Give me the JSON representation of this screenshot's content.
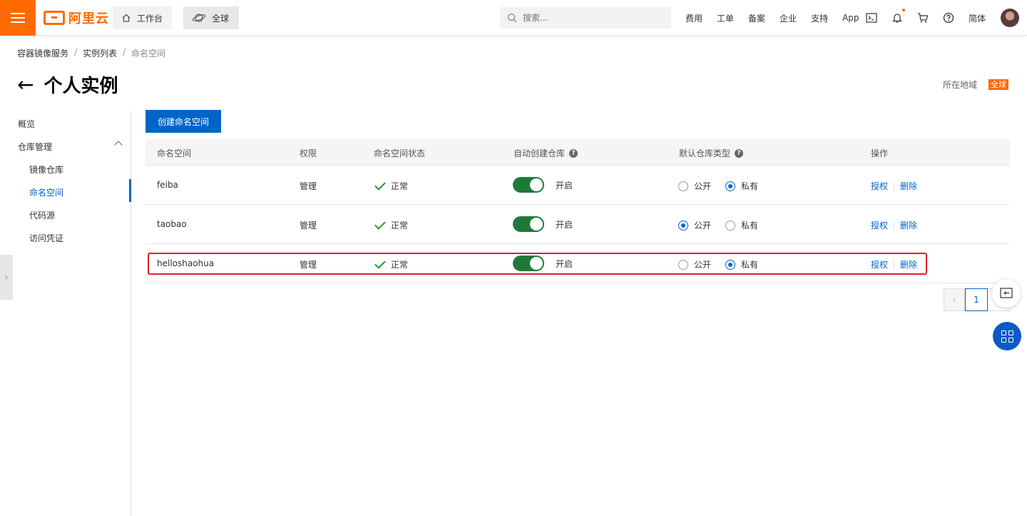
{
  "topbar": {
    "logo_text": "阿里云",
    "workbench_label": "工作台",
    "global_label": "全球",
    "search_placeholder": "搜索...",
    "nav": [
      "费用",
      "工单",
      "备案",
      "企业",
      "支持",
      "App"
    ],
    "lang_label": "简体",
    "accent_color": "#ff6a00"
  },
  "breadcrumb": {
    "items": [
      "容器镜像服务",
      "实例列表",
      "命名空间"
    ],
    "separator": "/"
  },
  "page": {
    "back_arrow": "←",
    "title": "个人实例",
    "region_label": "所在地域",
    "region_value": "全球"
  },
  "sidebar": {
    "overview": "概览",
    "repo_mgmt": "仓库管理",
    "items": [
      "镜像仓库",
      "命名空间",
      "代码源",
      "访问凭证"
    ],
    "active_item": "命名空间"
  },
  "toolbar": {
    "create_label": "创建命名空间"
  },
  "table": {
    "headers": {
      "namespace": "命名空间",
      "permission": "权限",
      "status": "命名空间状态",
      "auto_create": "自动创建仓库",
      "default_type": "默认仓库类型",
      "actions": "操作"
    },
    "help_icon": "?",
    "public_label": "公开",
    "private_label": "私有",
    "auth_label": "授权",
    "delete_label": "删除",
    "rows": [
      {
        "name": "feiba",
        "permission": "管理",
        "status": "正常",
        "auto": "开启",
        "default_type": "私有"
      },
      {
        "name": "taobao",
        "permission": "管理",
        "status": "正常",
        "auto": "开启",
        "default_type": "公开"
      },
      {
        "name": "helloshaohua",
        "permission": "管理",
        "status": "正常",
        "auto": "开启",
        "default_type": "私有"
      }
    ]
  },
  "pagination": {
    "prev": "‹",
    "current": "1"
  },
  "colors": {
    "primary": "#0064c8",
    "toggle_on": "#1f7a3a",
    "check": "#1e9a3b",
    "highlight": "#e02020"
  }
}
